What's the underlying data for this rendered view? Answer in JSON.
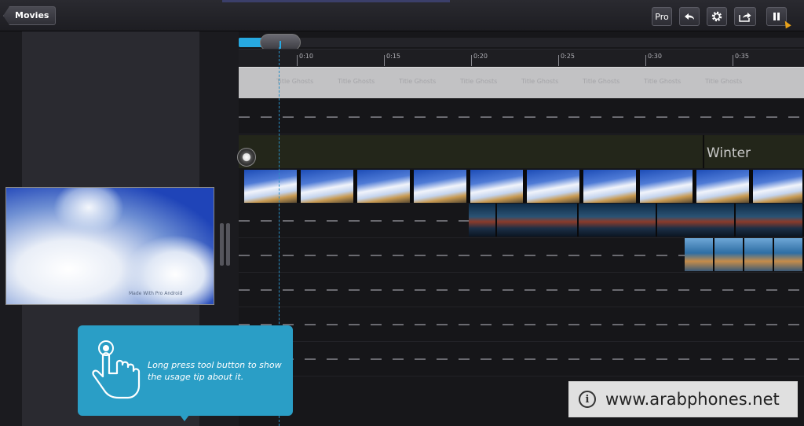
{
  "topbar": {
    "back_label": "Movies",
    "pro_label": "Pro"
  },
  "timeline": {
    "ruler_ticks": [
      "0:10",
      "0:15",
      "0:20",
      "0:25",
      "0:30",
      "0:35"
    ],
    "title_chip_text": "Title Ghosts",
    "music_clip_label": "Winter"
  },
  "preview": {
    "watermark": "Made With Pro Android"
  },
  "tooltip": {
    "text": "Long press tool button to show the usage tip about it."
  },
  "banner": {
    "info_icon": "i",
    "site": "www.arabphones.net"
  },
  "icons": {
    "undo": "undo-icon",
    "settings": "gear-icon",
    "share": "share-icon",
    "pause": "pause-icon"
  }
}
